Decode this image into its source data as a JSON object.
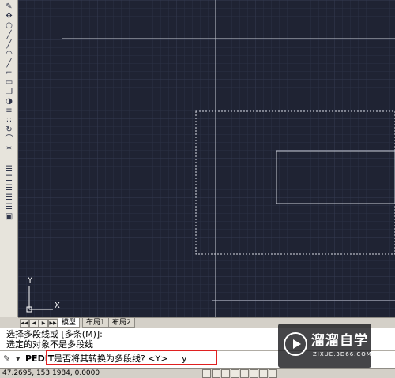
{
  "toolbar": {
    "icons": [
      "pencil-icon",
      "move-icon",
      "circle-icon",
      "line-icon",
      "line-icon",
      "arc-icon",
      "line-icon",
      "polyline-icon",
      "rectangle-icon",
      "copy-icon",
      "mirror-icon",
      "offset-icon",
      "array-icon",
      "rotate-icon",
      "fillet-icon",
      "explode-icon",
      "layer-icon",
      "layer-icon",
      "layer-icon",
      "layer-icon",
      "layer-icon",
      "block-icon"
    ]
  },
  "canvas": {
    "background": "#1f2333",
    "ucs_label_y": "Y",
    "ucs_label_x": "X"
  },
  "tabs": {
    "model": "模型",
    "layout1": "布局1",
    "layout2": "布局2"
  },
  "command_history": {
    "line1": "选择多段线或 [多条(M)]:",
    "line2": "选定的对象不是多段线"
  },
  "command_line": {
    "command": "PEDIT",
    "prompt": "是否将其转换为多段线? <Y>",
    "typed_value": "y",
    "highlight_color": "#e02020"
  },
  "status_bar": {
    "coordinates": "47.2695, 153.1984, 0.0000"
  },
  "watermark": {
    "name": "溜溜自学",
    "site": "ZIXUE.3D66.COM"
  }
}
